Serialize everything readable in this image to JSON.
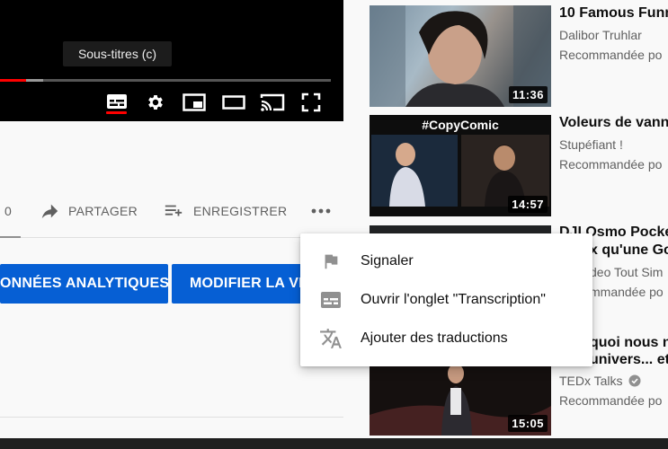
{
  "player": {
    "tooltip": "Sous-titres (c)",
    "progress_fraction": 0.08,
    "buffered_fraction": 0.13,
    "controls": [
      "subtitles-icon",
      "settings-icon",
      "miniplayer-icon",
      "theater-mode-icon",
      "cast-icon",
      "fullscreen-icon"
    ]
  },
  "actions": {
    "like_count": "0",
    "share_label": "PARTAGER",
    "save_label": "ENREGISTRER",
    "more_icon": "more-horiz-icon"
  },
  "buttons": {
    "analytics_label": "ONNÉES ANALYTIQUES",
    "edit_label": "MODIFIER LA VI"
  },
  "menu": {
    "items": [
      {
        "label": "Signaler",
        "icon": "flag-icon"
      },
      {
        "label": "Ouvrir l'onglet \"Transcription\"",
        "icon": "transcript-icon"
      },
      {
        "label": "Ajouter des traductions",
        "icon": "translate-icon"
      }
    ]
  },
  "sidebar": {
    "videos": [
      {
        "title": "10 Famous Funn",
        "channel": "Dalibor Truhlar",
        "status": "Recommandée po",
        "duration": "11:36"
      },
      {
        "title": "Voleurs de vann",
        "channel": "Stupéfiant !",
        "status": "Recommandée po",
        "duration": "14:57",
        "thumb_text": "#CopyComic"
      },
      {
        "title_line1": "DJI Osmo Pocke",
        "title_line2": "x qu'une Go",
        "channel": "deo Tout Sim",
        "status": "mmandée po"
      },
      {
        "title_line1": "quoi nous n",
        "title_line2": "univers... et",
        "channel": "TEDx Talks",
        "status": "Recommandée po",
        "duration": "15:05"
      }
    ]
  },
  "colors": {
    "accent_red": "#ff0000",
    "button_blue": "#065fd4",
    "page_bg": "#f9f9f9"
  }
}
